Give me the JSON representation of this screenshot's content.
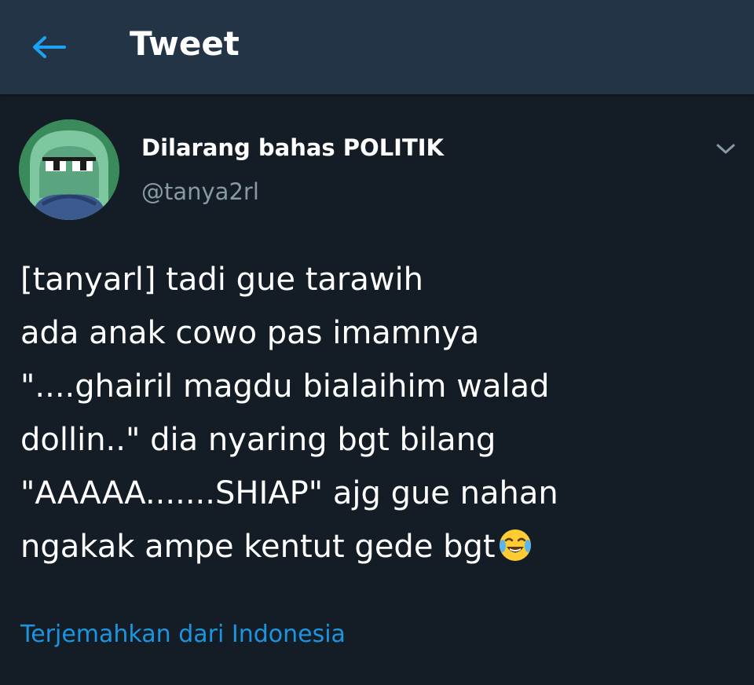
{
  "header": {
    "title": "Tweet",
    "back_icon": "back-arrow-icon"
  },
  "tweet": {
    "user": {
      "display_name": "Dilarang bahas POLITIK",
      "handle": "@tanya2rl"
    },
    "text_lines": [
      "[tanyarl] tadi gue tarawih",
      "ada anak cowo pas imamnya",
      "\"....ghairil magdu bialaihim walad",
      "dollin..\" dia nyaring bgt bilang",
      "\"AAAAA.......SHIAP\" ajg gue nahan",
      "ngakak ampe kentut gede bgt"
    ],
    "emoji": "crying-laughing-emoji",
    "translate_link": "Terjemahkan dari Indonesia"
  },
  "colors": {
    "background": "#141d26",
    "header_bg": "#243447",
    "accent": "#1b95e0",
    "muted_text": "#8899a6"
  }
}
